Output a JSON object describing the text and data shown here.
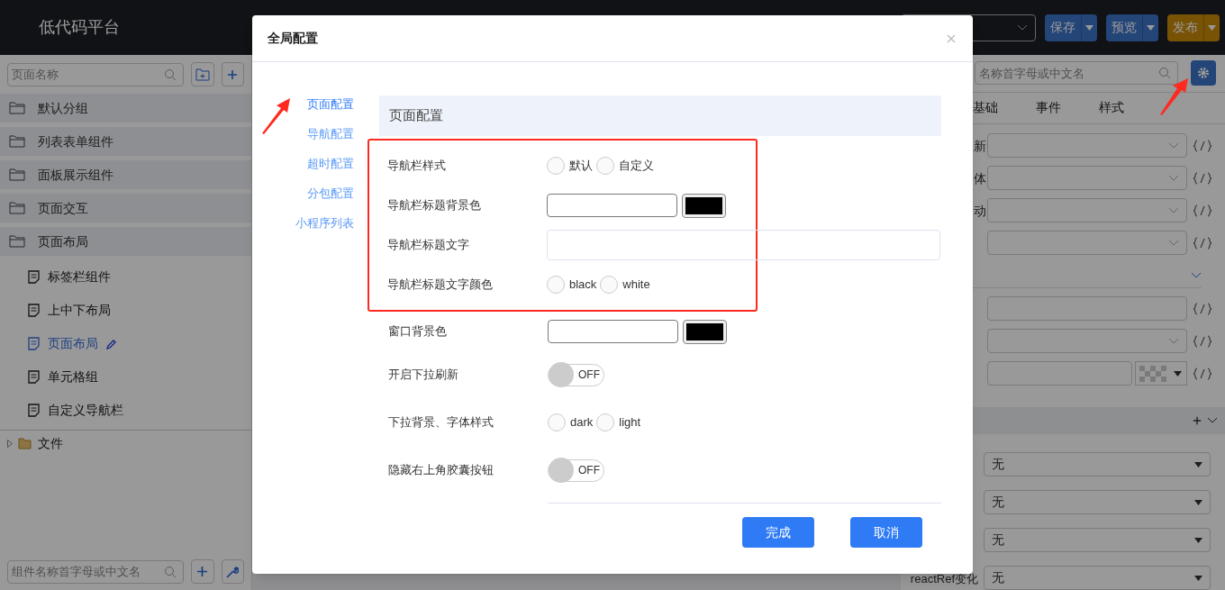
{
  "header": {
    "logo": "低代码平台",
    "buttons": [
      {
        "label": "保存",
        "kind": "primary"
      },
      {
        "label": "预览",
        "kind": "primary"
      },
      {
        "label": "发布",
        "kind": "publish"
      }
    ]
  },
  "left_panel": {
    "search": {
      "placeholder": "页面名称"
    },
    "groups": [
      {
        "label": "默认分组"
      },
      {
        "label": "列表表单组件"
      },
      {
        "label": "面板展示组件"
      },
      {
        "label": "页面交互"
      },
      {
        "label": "页面布局",
        "children": [
          {
            "label": "标签栏组件",
            "selected": false
          },
          {
            "label": "上中下布局",
            "selected": false
          },
          {
            "label": "页面布局",
            "selected": true
          },
          {
            "label": "单元格组",
            "selected": false
          },
          {
            "label": "自定义导航栏",
            "selected": false
          }
        ]
      }
    ],
    "file_tree": {
      "label": "文件",
      "expanded": false
    },
    "component_search": {
      "placeholder": "组件名称首字母或中文名"
    }
  },
  "right_panel": {
    "search": {
      "placeholder": "名称首字母或中文名"
    },
    "tabs": [
      "基础",
      "事件",
      "样式"
    ],
    "rows": [
      {
        "kind": "select",
        "label": "新"
      },
      {
        "kind": "select",
        "label": "体"
      },
      {
        "kind": "select",
        "label": "动"
      },
      {
        "kind": "select"
      },
      {
        "kind": "divider"
      },
      {
        "kind": "input"
      },
      {
        "kind": "select"
      },
      {
        "kind": "color"
      }
    ],
    "section_rows": [
      {
        "value": "无"
      },
      {
        "value": "无"
      },
      {
        "value": "无"
      },
      {
        "label": "reactRef变化",
        "value": "无"
      }
    ]
  },
  "dialog": {
    "title": "全局配置",
    "nav": [
      {
        "label": "页面配置",
        "selected": true
      },
      {
        "label": "导航配置",
        "selected": false
      },
      {
        "label": "超时配置",
        "selected": false
      },
      {
        "label": "分包配置",
        "selected": false
      },
      {
        "label": "小程序列表",
        "selected": false
      }
    ],
    "section_title": "页面配置",
    "highlighted_fields": [
      {
        "label": "导航栏样式",
        "kind": "radio",
        "options": [
          {
            "label": "默认",
            "selected": false
          },
          {
            "label": "自定义",
            "selected": false
          }
        ]
      },
      {
        "label": "导航栏标题背景色",
        "kind": "color",
        "color": "#000000"
      },
      {
        "label": "导航栏标题文字",
        "kind": "text"
      },
      {
        "label": "导航栏标题文字颜色",
        "kind": "radio",
        "options": [
          {
            "label": "black",
            "selected": false
          },
          {
            "label": "white",
            "selected": false
          }
        ]
      }
    ],
    "fields": [
      {
        "label": "窗口背景色",
        "kind": "color",
        "color": "#000000"
      },
      {
        "label": "开启下拉刷新",
        "kind": "toggle",
        "on": false,
        "state_label": "OFF"
      },
      {
        "label": "下拉背景、字体样式",
        "kind": "radio",
        "options": [
          {
            "label": "dark",
            "selected": false
          },
          {
            "label": "light",
            "selected": false
          }
        ]
      },
      {
        "label": "隐藏右上角胶囊按钮",
        "kind": "toggle",
        "on": false,
        "state_label": "OFF"
      }
    ],
    "buttons": [
      "完成",
      "取消"
    ]
  }
}
